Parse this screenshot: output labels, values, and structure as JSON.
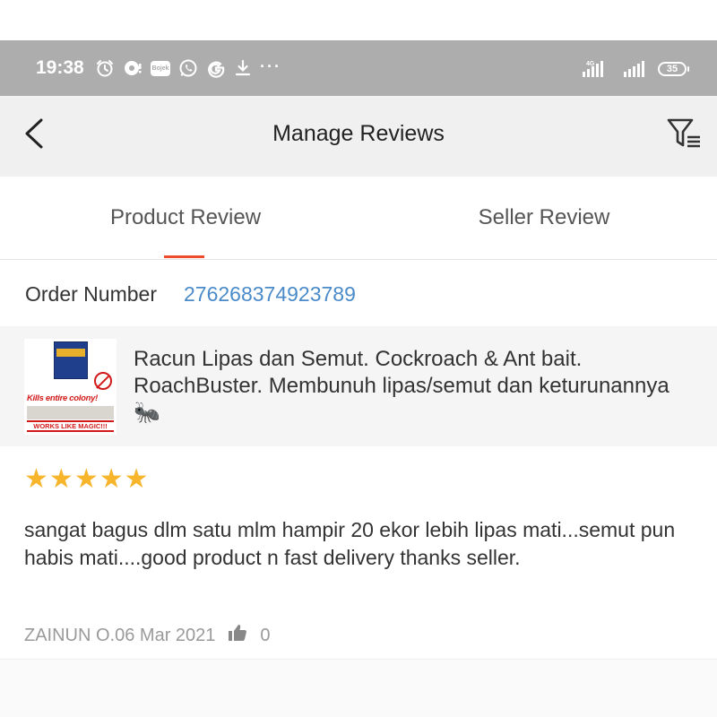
{
  "status_bar": {
    "time": "19:38",
    "icons_left": [
      "alarm-icon",
      "chat-bubble-icon",
      "app-badge-icon",
      "whatsapp-icon",
      "google-icon",
      "download-icon"
    ],
    "net_badge": "Bojek",
    "more": "···",
    "icons_right": [
      "signal-4g-icon",
      "signal-icon",
      "battery-icon"
    ],
    "network": "4G",
    "battery": "35"
  },
  "header": {
    "title": "Manage Reviews",
    "back_icon": "chevron-left-icon",
    "filter_icon": "filter-list-icon"
  },
  "tabs": [
    {
      "label": "Product Review",
      "active": true
    },
    {
      "label": "Seller Review",
      "active": false
    }
  ],
  "order": {
    "label": "Order Number",
    "number": "276268374923789"
  },
  "product": {
    "name": "Racun Lipas dan Semut. Cockroach & Ant bait. RoachBuster. Membunuh lipas/semut dan keturunannya",
    "name_emoji": "🐜",
    "thumbnail": {
      "kills_text": "Kills entire colony!",
      "magic_text": "WORKS LIKE MAGIC!!!"
    }
  },
  "review": {
    "rating": 5,
    "text": "sangat bagus dlm satu mlm hampir 20 ekor lebih lipas mati...semut pun habis mati....good product n fast delivery thanks seller.",
    "author_date": "ZAINUN O.06 Mar 2021",
    "likes": "0",
    "like_icon": "thumbs-up-icon"
  },
  "colors": {
    "accent": "#ee4d2d",
    "link": "#4a8ac9",
    "star": "#f7b52c",
    "status_bar": "#adadad",
    "header_bg": "#f0f0f0"
  }
}
